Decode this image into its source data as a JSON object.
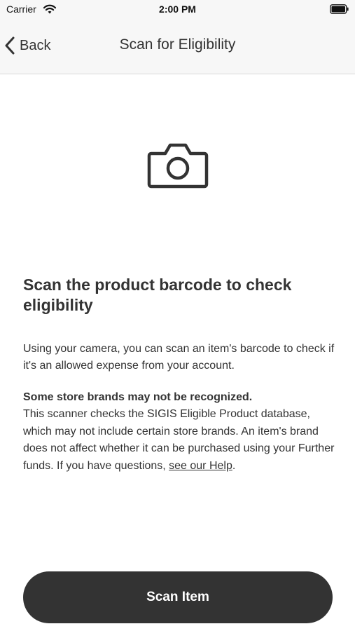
{
  "status_bar": {
    "carrier": "Carrier",
    "time": "2:00 PM",
    "wifi_icon": "wifi-icon",
    "battery_icon": "battery-icon"
  },
  "nav": {
    "back_label": "Back",
    "back_icon": "chevron-left-icon",
    "title": "Scan for Eligibility"
  },
  "hero": {
    "icon": "camera-icon"
  },
  "content": {
    "headline": "Scan the product barcode to check eligibility",
    "intro": "Using your camera, you can scan an item's barcode to check if it's an allowed expense from your account.",
    "notice_title": "Some store brands may not be recognized.",
    "notice_body": "This scanner checks the SIGIS Eligible Product database, which may not include certain store brands. An item's brand does not affect whether it can be purchased using your Further funds. If you have questions, ",
    "help_link": "see our Help",
    "notice_end": "."
  },
  "actions": {
    "scan_label": "Scan Item"
  },
  "colors": {
    "nav_background": "#f7f7f7",
    "text": "#333333",
    "button_background": "#333333",
    "button_text": "#ffffff"
  }
}
